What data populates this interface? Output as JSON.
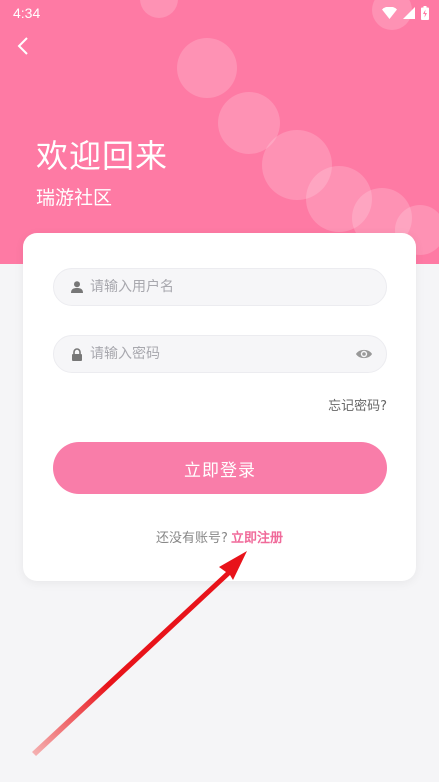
{
  "status_bar": {
    "time": "4:34"
  },
  "header": {
    "title": "欢迎回来",
    "subtitle": "瑞游社区"
  },
  "form": {
    "username": {
      "placeholder": "请输入用户名",
      "value": ""
    },
    "password": {
      "placeholder": "请输入密码",
      "value": ""
    },
    "forgot_label": "忘记密码?",
    "login_label": "立即登录",
    "register_prompt": "还没有账号?",
    "register_link": "立即注册"
  },
  "colors": {
    "brand_pink": "#fe7aa4",
    "button_pink": "#f97da9",
    "link_pink": "#f06a9a",
    "annotation_arrow": "#e8131a"
  }
}
